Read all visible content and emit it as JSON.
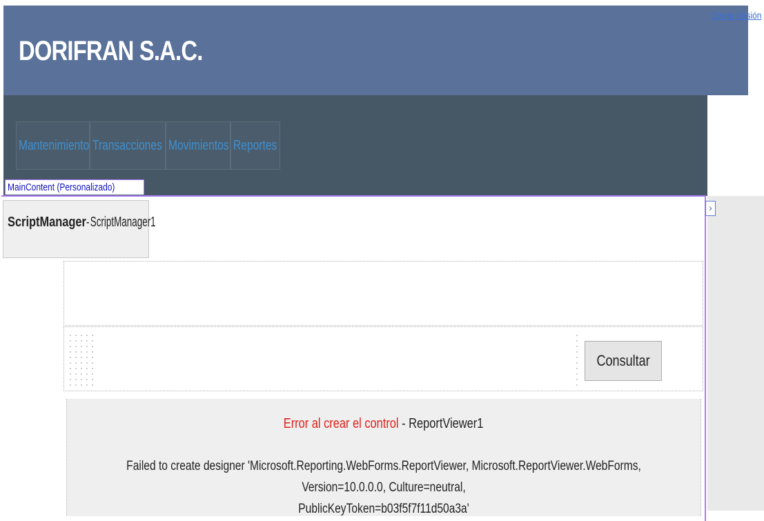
{
  "header": {
    "brand": "DORIFRAN S.A.C.",
    "logout": "Cerrar Sesión"
  },
  "nav": {
    "items": [
      {
        "label": "Mantenimiento"
      },
      {
        "label": "Transacciones"
      },
      {
        "label": "Movimientos"
      },
      {
        "label": "Reportes"
      }
    ]
  },
  "designer": {
    "content_label": "MainContent (Personalizado)",
    "script_manager_type": "ScriptManager",
    "script_manager_sep": " - ",
    "script_manager_id": "ScriptManager1"
  },
  "form": {
    "consultar_label": "Consultar"
  },
  "report_viewer": {
    "error_label": "Error al crear el control",
    "sep": " - ",
    "control_id": "ReportViewer1",
    "message_line1": "Failed to create designer 'Microsoft.Reporting.WebForms.ReportViewer, Microsoft.ReportViewer.WebForms, Version=10.0.0.0, Culture=neutral,",
    "message_line2": "PublicKeyToken=b03f5f7f11d50a3a'"
  },
  "colors": {
    "header_bg": "#5a7199",
    "nav_bg": "#465766",
    "link": "#3f8fd0",
    "error": "#e0201a",
    "designer_border": "#a77cf0"
  }
}
